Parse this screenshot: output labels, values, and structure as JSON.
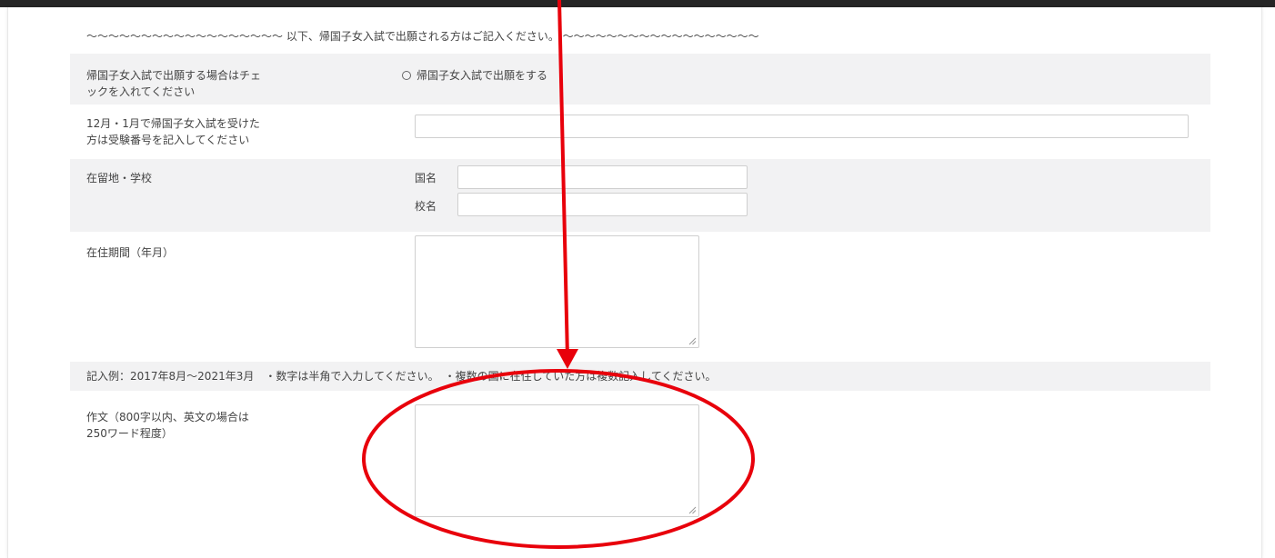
{
  "separator_text": "〜〜〜〜〜〜〜〜〜〜〜〜〜〜〜〜〜〜 以下、帰国子女入試で出願される方はご記入ください。 〜〜〜〜〜〜〜〜〜〜〜〜〜〜〜〜〜〜",
  "returnee_check": {
    "label": "帰国子女入試で出願する場合はチェ\nックを入れてください",
    "option": "帰国子女入試で出願をする"
  },
  "exam_number": {
    "label": "12月・1月で帰国子女入試を受けた\n方は受験番号を記入してください",
    "value": ""
  },
  "residence": {
    "label": "在留地・学校",
    "country_label": "国名",
    "country_value": "",
    "school_label": "校名",
    "school_value": ""
  },
  "period": {
    "label": "在住期間（年月）",
    "value": ""
  },
  "example_note": "記入例：2017年8月〜2021年3月　・数字は半角で入力してください。　・複数の国に在住していた方は複数記入してください。",
  "essay": {
    "label": "作文（800字以内、英文の場合は\n250ワード程度）",
    "value": ""
  },
  "annotation": {
    "color": "#e8000b"
  }
}
